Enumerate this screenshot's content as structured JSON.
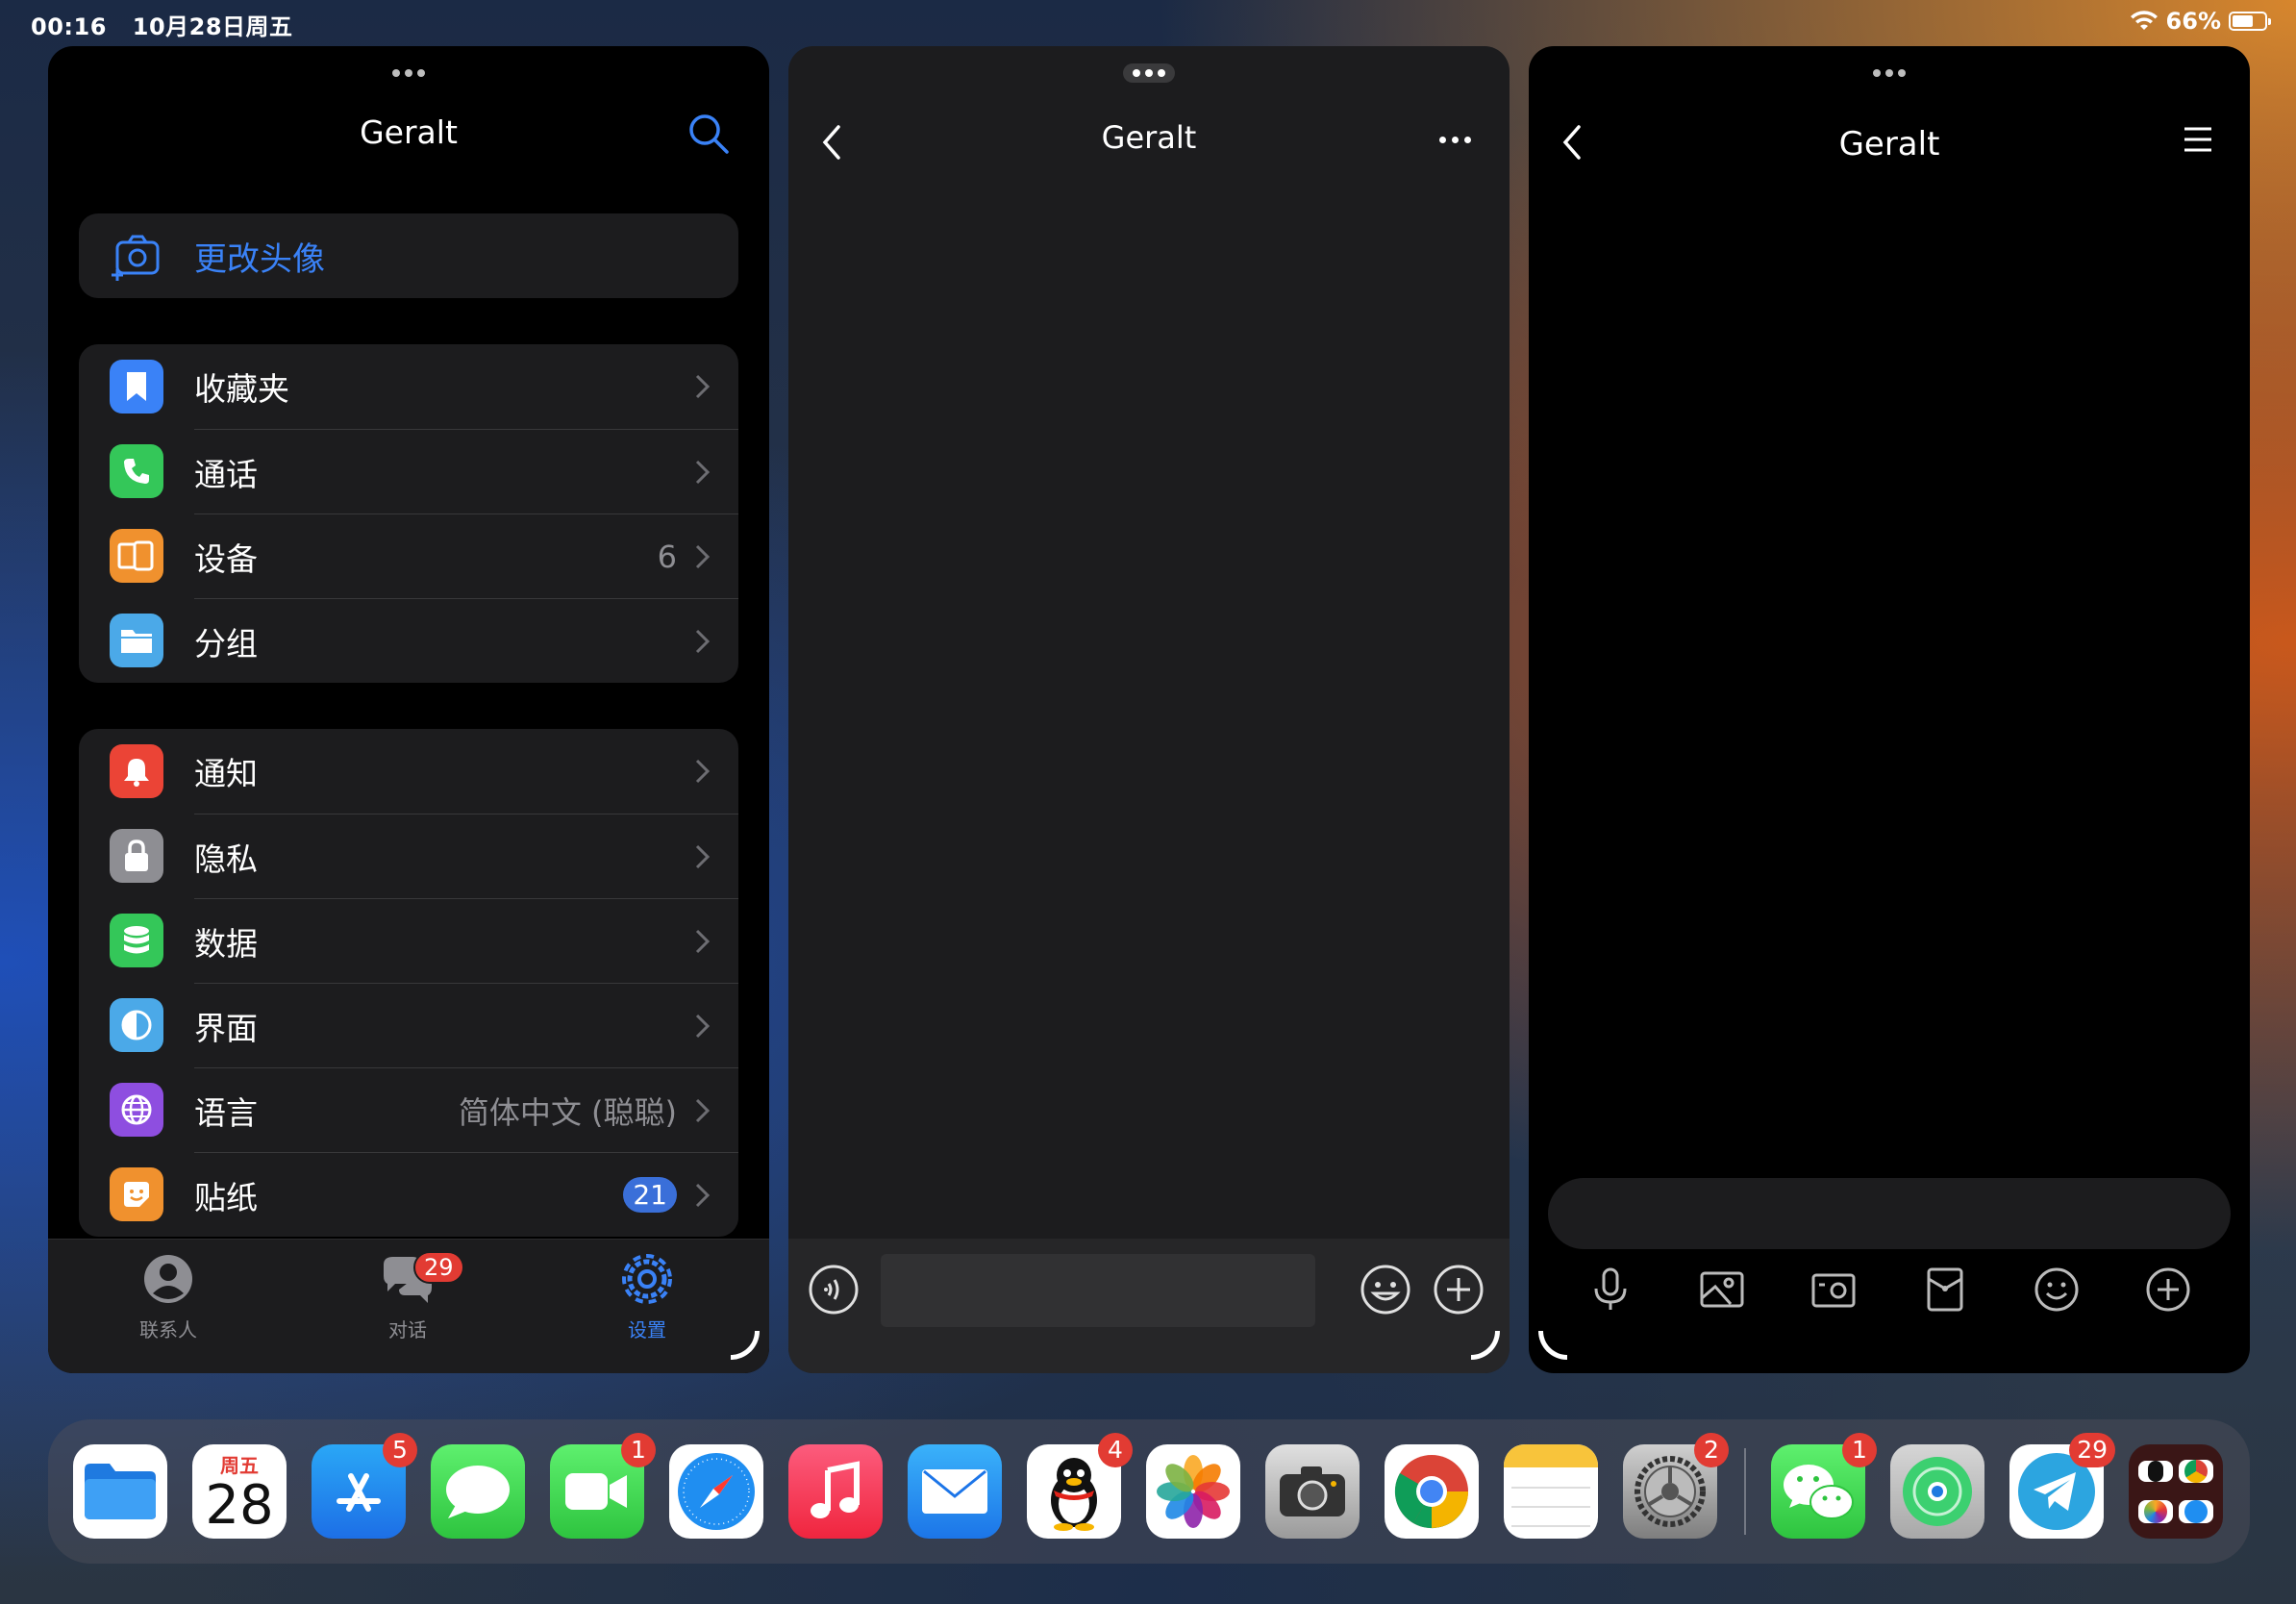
{
  "status_bar": {
    "time": "00:16",
    "date": "10月28日周五",
    "battery": "66%",
    "battery_level": 0.66
  },
  "settings_window": {
    "title": "Geralt",
    "change_avatar": "更改头像",
    "group1": [
      {
        "label": "收藏夹",
        "icon": "bookmark-icon",
        "color": "#3a82f7",
        "value": ""
      },
      {
        "label": "通话",
        "icon": "phone-icon",
        "color": "#34c759",
        "value": ""
      },
      {
        "label": "设备",
        "icon": "devices-icon",
        "color": "#f0912e",
        "value": "6"
      },
      {
        "label": "分组",
        "icon": "folder-icon",
        "color": "#4ba9e8",
        "value": ""
      }
    ],
    "group2": [
      {
        "label": "通知",
        "icon": "bell-icon",
        "color": "#eb4436",
        "value": ""
      },
      {
        "label": "隐私",
        "icon": "lock-icon",
        "color": "#8e8e93",
        "value": ""
      },
      {
        "label": "数据",
        "icon": "database-icon",
        "color": "#34c759",
        "value": ""
      },
      {
        "label": "界面",
        "icon": "appearance-icon",
        "color": "#4ba9e8",
        "value": ""
      },
      {
        "label": "语言",
        "icon": "globe-icon",
        "color": "#8e4ee0",
        "value": "简体中文 (聪聪)"
      },
      {
        "label": "贴纸",
        "icon": "sticker-icon",
        "color": "#f0912e",
        "badge": "21"
      }
    ],
    "tabs": {
      "contacts": "联系人",
      "chats": "对话",
      "chats_badge": "29",
      "settings": "设置"
    }
  },
  "chat_window": {
    "title": "Geralt"
  },
  "qq_window": {
    "title": "Geralt"
  },
  "dock": {
    "calendar_weekday": "周五",
    "calendar_day": "28",
    "apps": [
      {
        "name": "Files",
        "badge": ""
      },
      {
        "name": "Calendar",
        "badge": ""
      },
      {
        "name": "App Store",
        "badge": "5"
      },
      {
        "name": "Messages",
        "badge": ""
      },
      {
        "name": "FaceTime",
        "badge": "1"
      },
      {
        "name": "Safari",
        "badge": ""
      },
      {
        "name": "Music",
        "badge": ""
      },
      {
        "name": "Mail",
        "badge": ""
      },
      {
        "name": "QQ",
        "badge": "4"
      },
      {
        "name": "Photos",
        "badge": ""
      },
      {
        "name": "Camera",
        "badge": ""
      },
      {
        "name": "Chrome",
        "badge": ""
      },
      {
        "name": "Notes",
        "badge": ""
      },
      {
        "name": "Settings",
        "badge": "2"
      },
      {
        "name": "WeChat",
        "badge": "1"
      },
      {
        "name": "Find My",
        "badge": ""
      },
      {
        "name": "Telegram",
        "badge": "29"
      },
      {
        "name": "App Library",
        "badge": ""
      }
    ]
  }
}
